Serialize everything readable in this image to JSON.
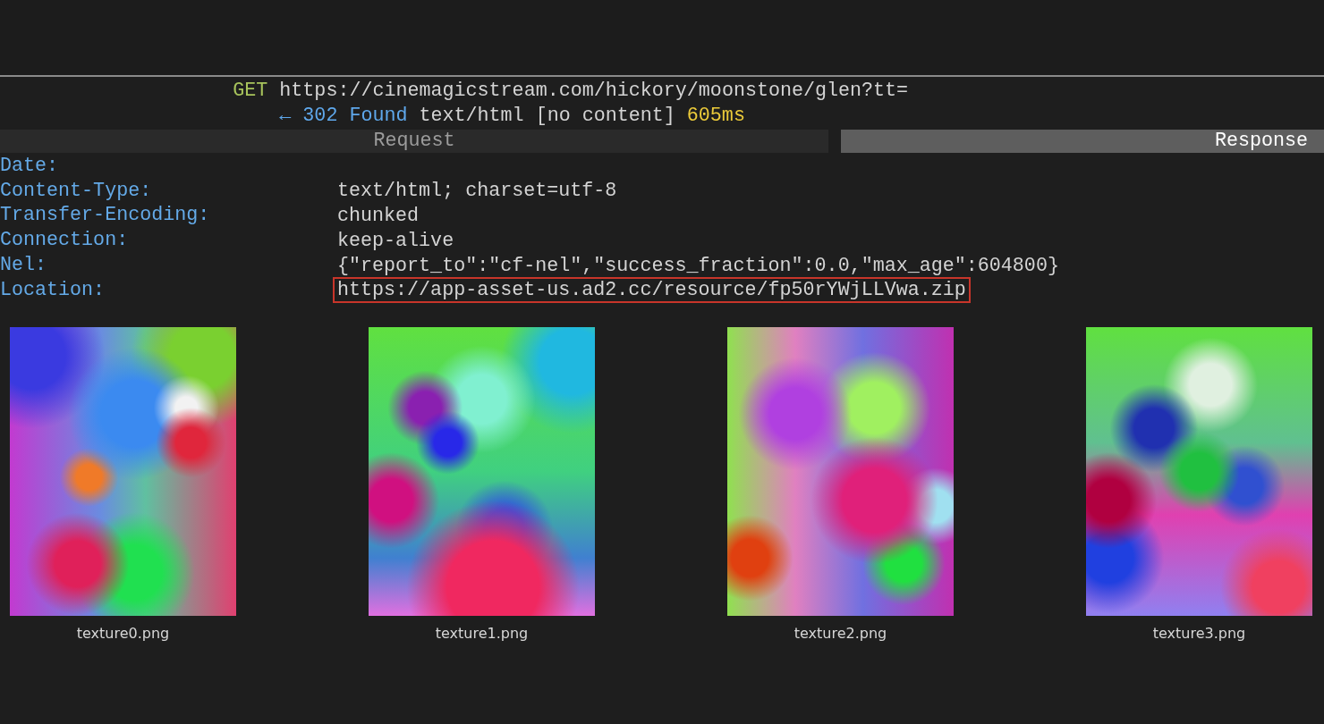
{
  "request_line": {
    "method": "GET",
    "url": "https://cinemagicstream.com/hickory/moonstone/glen?tt="
  },
  "response_line": {
    "arrow": "←",
    "status": "302 Found",
    "content_type": "text/html",
    "body_note": "[no content]",
    "duration": "605ms"
  },
  "tabs": [
    {
      "label": "Request",
      "selected": false
    },
    {
      "label": "Response",
      "selected": true
    }
  ],
  "headers": [
    {
      "name": "Date:",
      "highlighted": false
    },
    {
      "name": "Content-Type:",
      "value": "text/html; charset=utf-8",
      "highlighted": false
    },
    {
      "name": "Transfer-Encoding:",
      "value": "chunked",
      "highlighted": false
    },
    {
      "name": "Connection:",
      "value": "keep-alive",
      "highlighted": false
    },
    {
      "name": "Nel:",
      "value": "{\"report_to\":\"cf-nel\",\"success_fraction\":0.0,\"max_age\":604800}",
      "highlighted": false
    },
    {
      "name": "Location:",
      "value": "https://app-asset-us.ad2.cc/resource/fp50rYWjLLVwa.zip",
      "highlighted": true
    }
  ],
  "images": [
    {
      "filename": "texture0.png"
    },
    {
      "filename": "texture1.png"
    },
    {
      "filename": "texture2.png"
    },
    {
      "filename": "texture3.png"
    }
  ]
}
